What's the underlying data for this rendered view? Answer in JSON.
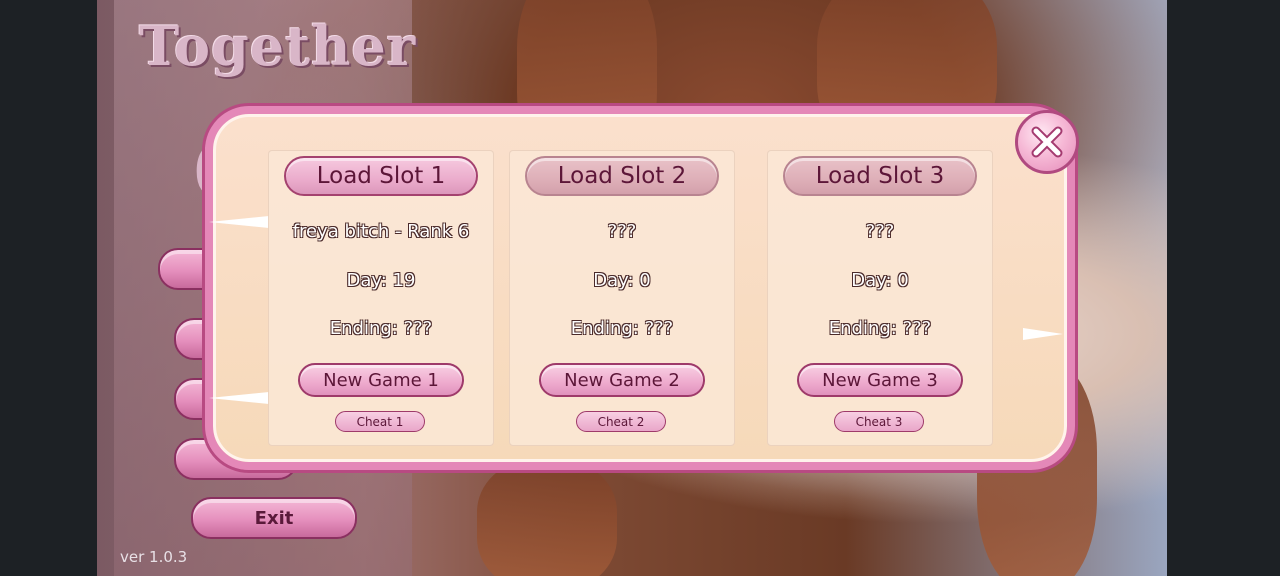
{
  "title_menu": {
    "logo_text": "Together",
    "logo_partial": "6",
    "exit_label": "Exit",
    "version": "ver 1.0.3"
  },
  "dialog": {
    "close_icon": "close-icon",
    "slots": [
      {
        "load_label": "Load Slot 1",
        "name": "freya bitch - Rank 6",
        "day": "Day: 19",
        "ending": "Ending: ???",
        "new_game_label": "New Game 1",
        "cheat_label": "Cheat 1"
      },
      {
        "load_label": "Load Slot 2",
        "name": "???",
        "day": "Day: 0",
        "ending": "Ending: ???",
        "new_game_label": "New Game 2",
        "cheat_label": "Cheat 2"
      },
      {
        "load_label": "Load Slot 3",
        "name": "???",
        "day": "Day: 0",
        "ending": "Ending: ???",
        "new_game_label": "New Game 3",
        "cheat_label": "Cheat 3"
      }
    ]
  },
  "colors": {
    "accent_pink": "#e488b8",
    "panel_cream": "#f6d9b9",
    "button_text": "#5c1638"
  }
}
